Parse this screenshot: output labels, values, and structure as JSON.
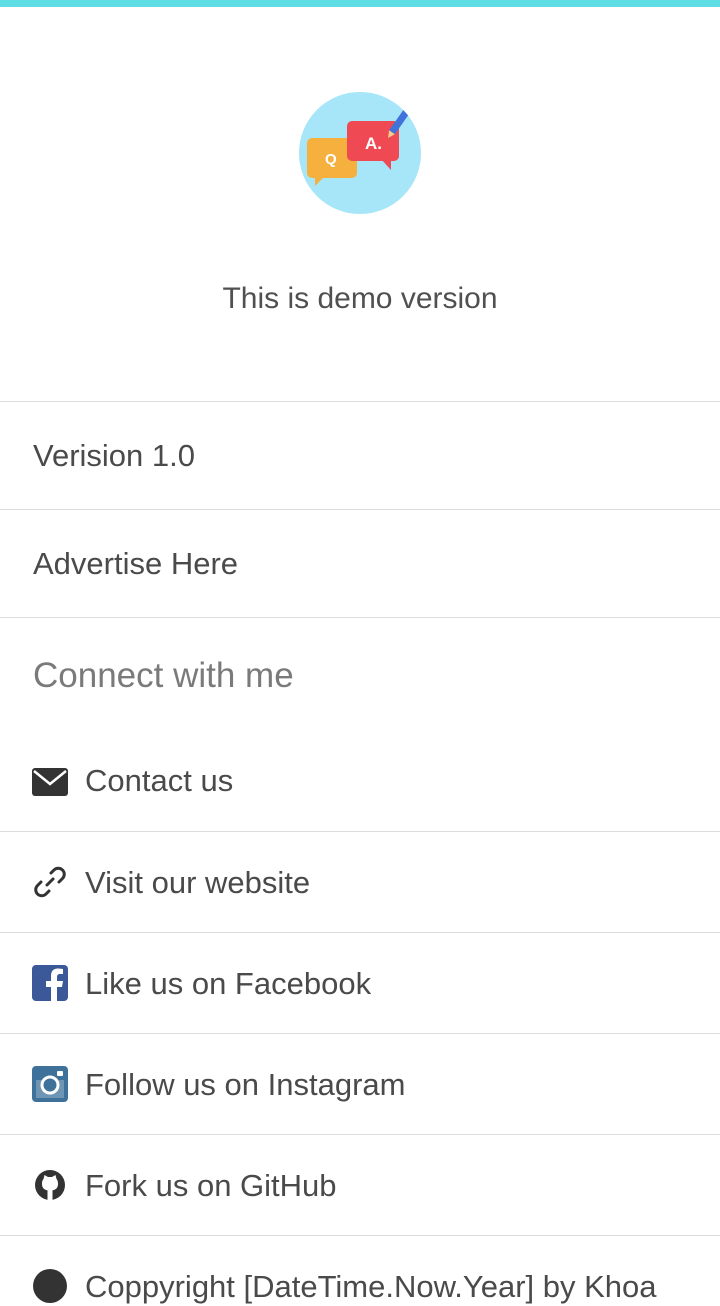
{
  "header": {
    "accent_color": "#5fdde5",
    "logo_icon": "qa-chat-bubbles-icon",
    "demo_text": "This is demo version"
  },
  "info": {
    "version": "Verision 1.0",
    "advertise": "Advertise Here"
  },
  "connect": {
    "heading": "Connect with me",
    "items": [
      {
        "label": "Contact us",
        "icon": "envelope-icon"
      },
      {
        "label": "Visit our website",
        "icon": "link-icon"
      },
      {
        "label": "Like us on Facebook",
        "icon": "facebook-icon",
        "color": "#3b5998"
      },
      {
        "label": "Follow us on Instagram",
        "icon": "instagram-icon",
        "color": "#3f729b"
      },
      {
        "label": "Fork us on GitHub",
        "icon": "github-icon"
      },
      {
        "label": "Coppyright [DateTime.Now.Year] by Khoa",
        "icon": "copyright-icon"
      }
    ]
  }
}
